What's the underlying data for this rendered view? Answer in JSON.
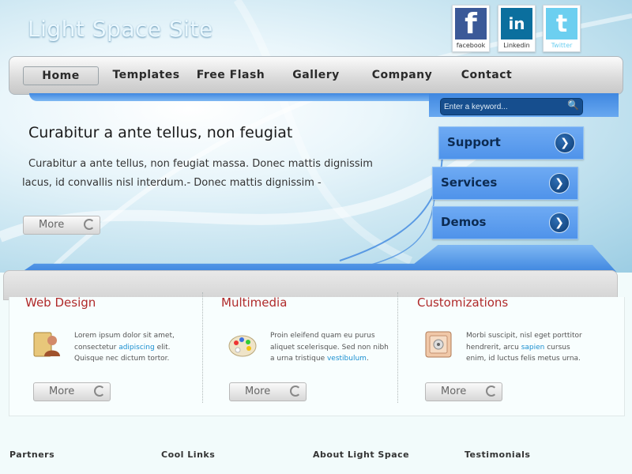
{
  "site_title": "Light Space Site",
  "social": [
    {
      "name": "facebook",
      "caption": "facebook",
      "glyph": "f"
    },
    {
      "name": "linkedin",
      "caption": "Linkedin",
      "glyph": "in"
    },
    {
      "name": "twitter",
      "caption": "Twitter",
      "glyph": "t"
    }
  ],
  "nav": {
    "items": [
      "Home",
      "Templates",
      "Free Flash",
      "Gallery",
      "Company",
      "Contact"
    ],
    "active": "Home"
  },
  "search": {
    "placeholder": "Enter a keyword..."
  },
  "side_buttons": [
    "Support",
    "Services",
    "Demos"
  ],
  "hero": {
    "heading": "Curabitur a ante tellus, non feugiat",
    "text": "Curabitur a ante tellus, non feugiat massa. Donec mattis dignissim lacus, id convallis nisl interdum.- Donec mattis dignissim -",
    "more": "More"
  },
  "features": [
    {
      "title": "Web Design",
      "text_a": "Lorem ipsum dolor sit amet, consectetur ",
      "highlight": "adipiscing",
      "text_b": " elit. Quisque nec dictum tortor.",
      "more": "More",
      "icon": "user-profile-icon"
    },
    {
      "title": "Multimedia",
      "text_a": "Proin eleifend quam eu purus aliquet scelerisque. Sed non nibh a urna tristique ",
      "highlight": "vestibulum",
      "text_b": ".",
      "more": "More",
      "icon": "paint-palette-icon"
    },
    {
      "title": "Customizations",
      "text_a": "Morbi suscipit, nisl eget porttitor hendrerit, arcu ",
      "highlight": "sapien",
      "text_b": " cursus enim, id luctus felis metus urna.",
      "more": "More",
      "icon": "safe-icon"
    }
  ],
  "footer": [
    "Partners",
    "Cool Links",
    "About Light Space",
    "Testimonials"
  ],
  "colors": {
    "accent_blue": "#4f93ea",
    "feature_title": "#b02a2a",
    "link": "#1a8fd0"
  }
}
